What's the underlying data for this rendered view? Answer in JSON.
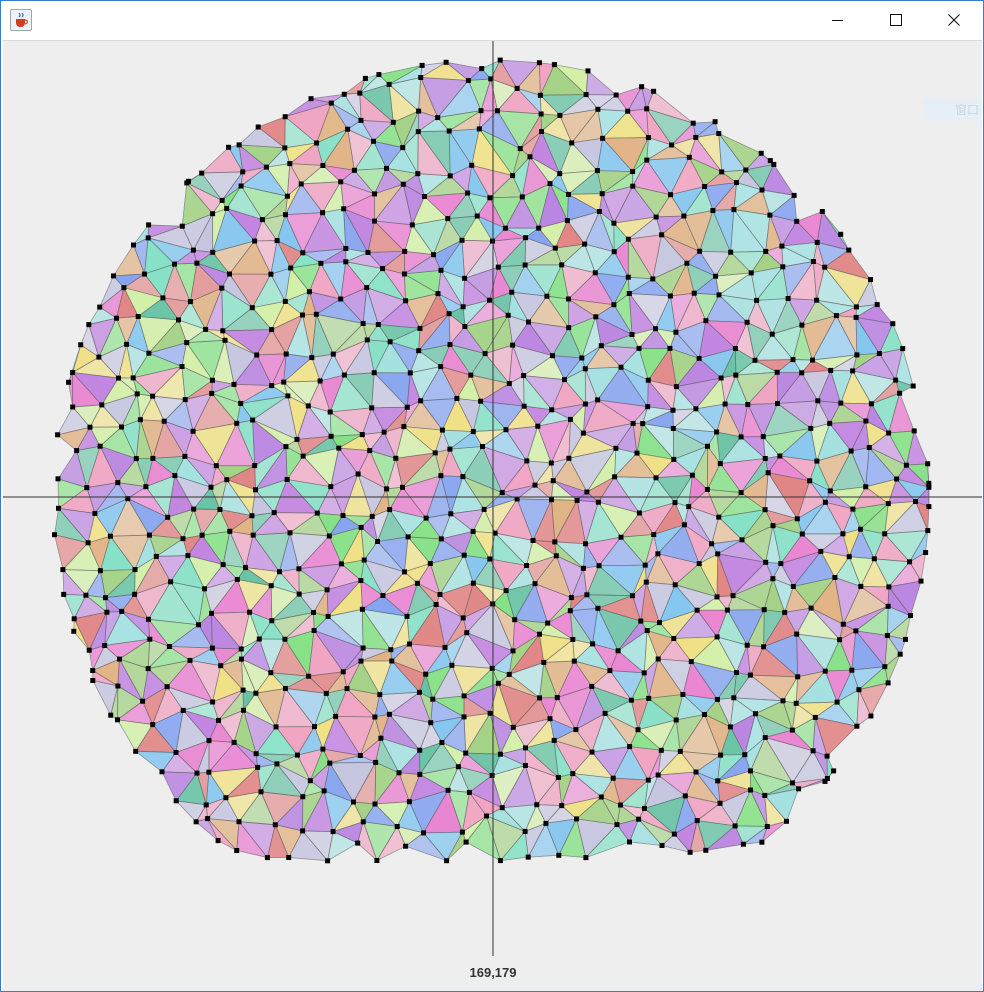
{
  "window": {
    "icon": "java-coffee-icon",
    "controls": [
      "minimize-icon",
      "maximize-icon",
      "close-icon"
    ]
  },
  "canvas": {
    "background": "#eeeeee",
    "crosshair_color": "#333333",
    "point_color": "#000000",
    "cursor_coordinates": "169,179",
    "ghost_label": "窗口"
  }
}
